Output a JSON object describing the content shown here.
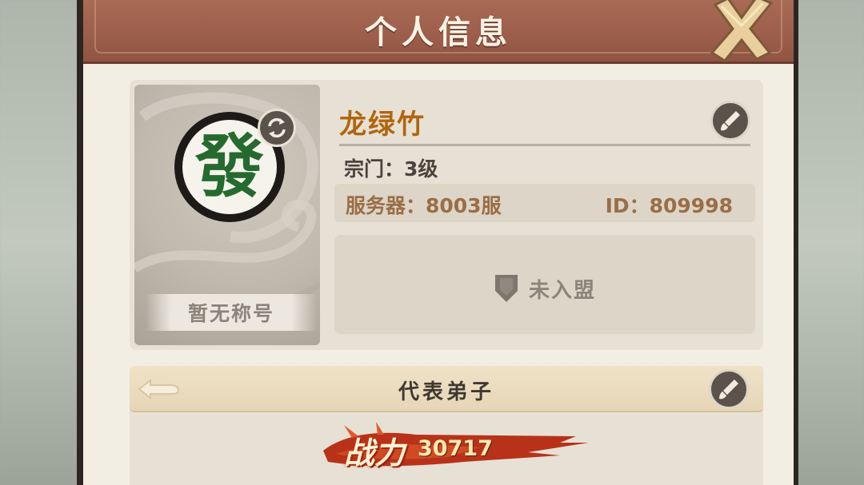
{
  "header": {
    "title": "个人信息"
  },
  "profile": {
    "avatar_glyph": "發",
    "title_badge": "暂无称号",
    "name": "龙绿竹",
    "sect": "宗门：3级",
    "server": "服务器：8003服",
    "id": "ID：809998",
    "alliance": "未入盟"
  },
  "representative": {
    "section_title": "代表弟子",
    "power_label": "战力",
    "power_value": "30717"
  },
  "colors": {
    "header_bg": "#9c5e4a",
    "name": "#b0660e",
    "server_text": "#9a6e46",
    "avatar_glyph": "#256a2e",
    "power_brush": "#b8321a"
  },
  "icons": {
    "close": "close-x-icon",
    "swap": "swap-arrows-icon",
    "edit": "brush-edit-icon",
    "alliance": "shield-icon"
  }
}
